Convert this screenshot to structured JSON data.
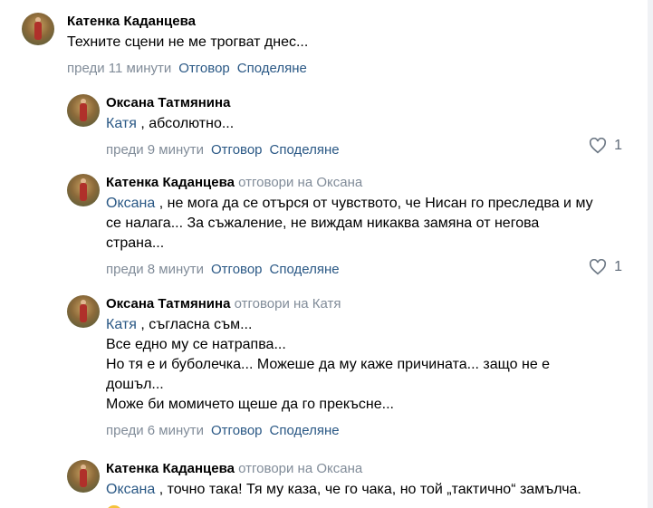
{
  "comments": [
    {
      "author": "Катенка Каданцева",
      "replied_to": "",
      "mention": "",
      "text": "Техните сцени не ме трогват днес...",
      "lines": [],
      "time": "преди 11 минути",
      "reply_label": "Отговор",
      "share_label": "Споделяне",
      "likes": ""
    },
    {
      "author": "Оксана Татмянина",
      "replied_to": "",
      "mention": "Катя",
      "text": ", абсолютно...",
      "lines": [],
      "time": "преди 9 минути",
      "reply_label": "Отговор",
      "share_label": "Споделяне",
      "likes": "1"
    },
    {
      "author": "Катенка Каданцева",
      "replied_to": "отговори на Оксана",
      "mention": "Оксана",
      "text": ", не мога да се отърся от чувството, че Нисан го преследва и му",
      "lines": [
        "се налага... За съжаление, не виждам никаква замяна от негова",
        "страна..."
      ],
      "time": "преди 8 минути",
      "reply_label": "Отговор",
      "share_label": "Споделяне",
      "likes": "1"
    },
    {
      "author": "Оксана Татмянина",
      "replied_to": "отговори на Катя",
      "mention": "Катя",
      "text": ", съгласна съм...",
      "lines": [
        "Все едно му се натрапва...",
        "Но тя е и буболечка... Можеше да му каже причината... защо не е",
        "дошъл...",
        "Може би момичето щеше да го прекъсне..."
      ],
      "time": "преди 6 минути",
      "reply_label": "Отговор",
      "share_label": "Споделяне",
      "likes": ""
    },
    {
      "author": "Катенка Каданцева",
      "replied_to": "отговори на Оксана",
      "mention": "Оксана",
      "text": ", точно така! Тя му каза, че го чака, но той „тактично“ замълча.",
      "lines": [],
      "time": "",
      "reply_label": "",
      "share_label": "",
      "likes": ""
    }
  ]
}
